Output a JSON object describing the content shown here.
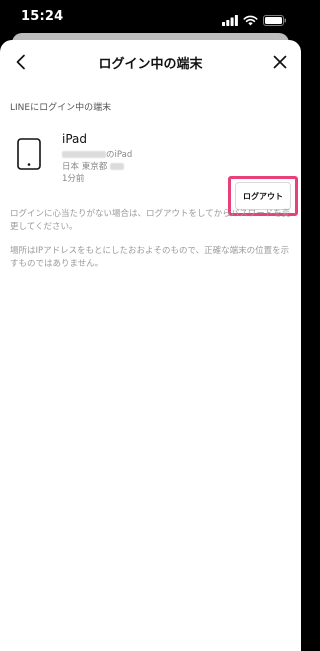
{
  "status": {
    "time": "15:24"
  },
  "nav": {
    "title": "ログイン中の端末"
  },
  "section": {
    "label": "LINEにログイン中の端末"
  },
  "device": {
    "name": "iPad",
    "owner_suffix": "のiPad",
    "location": "日本 東京都",
    "last_active": "1分前",
    "logout_label": "ログアウト"
  },
  "info": {
    "paragraph1": "ログインに心当たりがない場合は、ログアウトをしてからパスワードを変更してください。",
    "paragraph2": "場所はIPアドレスをもとにしたおおよそのもので、正確な端末の位置を示すものではありません。"
  },
  "colors": {
    "highlight": "#e8407a",
    "background": "#000000",
    "sheet": "#ffffff"
  }
}
